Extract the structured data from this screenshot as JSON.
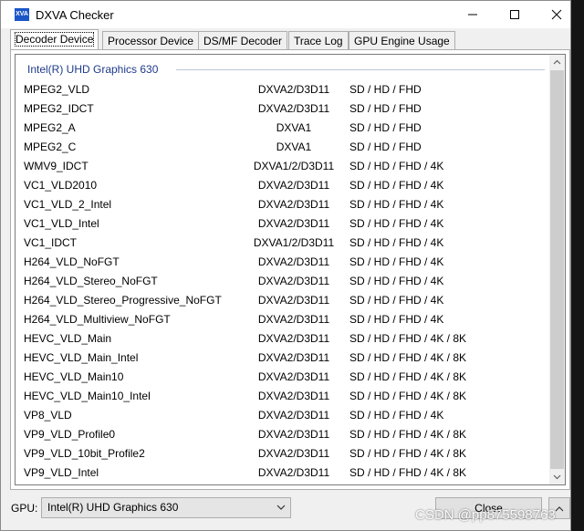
{
  "window": {
    "title": "DXVA Checker",
    "icon_text": "XVA"
  },
  "tabs": [
    {
      "label": "Decoder Device",
      "active": true
    },
    {
      "label": "Processor Device"
    },
    {
      "label": "DS/MF Decoder"
    },
    {
      "label": "Trace Log"
    },
    {
      "label": "GPU Engine Usage"
    }
  ],
  "group_header": "Intel(R) UHD Graphics 630",
  "rows": [
    {
      "name": "MPEG2_VLD",
      "api": "DXVA2/D3D11",
      "res": "SD / HD / FHD"
    },
    {
      "name": "MPEG2_IDCT",
      "api": "DXVA2/D3D11",
      "res": "SD / HD / FHD"
    },
    {
      "name": "MPEG2_A",
      "api": "DXVA1",
      "res": "SD / HD / FHD"
    },
    {
      "name": "MPEG2_C",
      "api": "DXVA1",
      "res": "SD / HD / FHD"
    },
    {
      "name": "WMV9_IDCT",
      "api": "DXVA1/2/D3D11",
      "res": "SD / HD / FHD / 4K"
    },
    {
      "name": "VC1_VLD2010",
      "api": "DXVA2/D3D11",
      "res": "SD / HD / FHD / 4K"
    },
    {
      "name": "VC1_VLD_2_Intel",
      "api": "DXVA2/D3D11",
      "res": "SD / HD / FHD / 4K"
    },
    {
      "name": "VC1_VLD_Intel",
      "api": "DXVA2/D3D11",
      "res": "SD / HD / FHD / 4K"
    },
    {
      "name": "VC1_IDCT",
      "api": "DXVA1/2/D3D11",
      "res": "SD / HD / FHD / 4K"
    },
    {
      "name": "H264_VLD_NoFGT",
      "api": "DXVA2/D3D11",
      "res": "SD / HD / FHD / 4K"
    },
    {
      "name": "H264_VLD_Stereo_NoFGT",
      "api": "DXVA2/D3D11",
      "res": "SD / HD / FHD / 4K"
    },
    {
      "name": "H264_VLD_Stereo_Progressive_NoFGT",
      "api": "DXVA2/D3D11",
      "res": "SD / HD / FHD / 4K"
    },
    {
      "name": "H264_VLD_Multiview_NoFGT",
      "api": "DXVA2/D3D11",
      "res": "SD / HD / FHD / 4K"
    },
    {
      "name": "HEVC_VLD_Main",
      "api": "DXVA2/D3D11",
      "res": "SD / HD / FHD / 4K / 8K"
    },
    {
      "name": "HEVC_VLD_Main_Intel",
      "api": "DXVA2/D3D11",
      "res": "SD / HD / FHD / 4K / 8K"
    },
    {
      "name": "HEVC_VLD_Main10",
      "api": "DXVA2/D3D11",
      "res": "SD / HD / FHD / 4K / 8K"
    },
    {
      "name": "HEVC_VLD_Main10_Intel",
      "api": "DXVA2/D3D11",
      "res": "SD / HD / FHD / 4K / 8K"
    },
    {
      "name": "VP8_VLD",
      "api": "DXVA2/D3D11",
      "res": "SD / HD / FHD / 4K"
    },
    {
      "name": "VP9_VLD_Profile0",
      "api": "DXVA2/D3D11",
      "res": "SD / HD / FHD / 4K / 8K"
    },
    {
      "name": "VP9_VLD_10bit_Profile2",
      "api": "DXVA2/D3D11",
      "res": "SD / HD / FHD / 4K / 8K"
    },
    {
      "name": "VP9_VLD_Intel",
      "api": "DXVA2/D3D11",
      "res": "SD / HD / FHD / 4K / 8K"
    }
  ],
  "footer": {
    "gpu_label": "GPU:",
    "gpu_value": "Intel(R) UHD Graphics 630",
    "close_label": "Close"
  },
  "watermark": "CSDN @pp875598763",
  "colors": {
    "group_header": "#1e3a8a",
    "icon_bg": "#1a56c8"
  }
}
